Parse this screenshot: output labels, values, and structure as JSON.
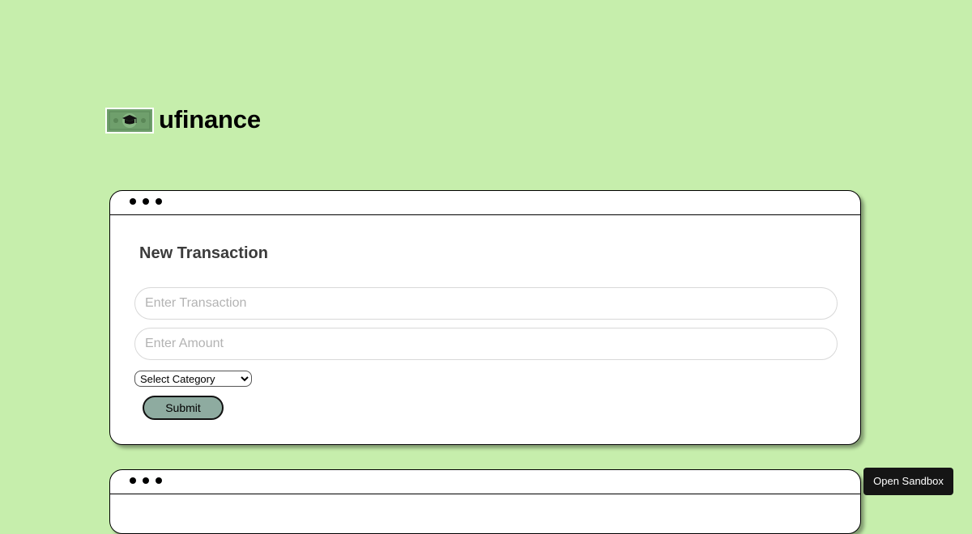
{
  "brand": {
    "name": "ufinance",
    "logo_icon": "graduation-cap-banknote-icon"
  },
  "colors": {
    "page_background": "#c6eeac",
    "submit_background": "#8eaba0",
    "logo_green": "#6f9f6c",
    "sandbox_button_background": "#151515"
  },
  "transaction_card": {
    "window_dots_icon": "window-dots-icon",
    "title": "New Transaction",
    "transaction_placeholder": "Enter Transaction",
    "transaction_value": "",
    "amount_placeholder": "Enter Amount",
    "amount_value": "",
    "category_select": {
      "selected": "Select Category",
      "options": [
        "Select Category"
      ]
    },
    "submit_label": "Submit"
  },
  "second_card": {
    "window_dots_icon": "window-dots-icon"
  },
  "sandbox": {
    "label": "Open Sandbox"
  }
}
